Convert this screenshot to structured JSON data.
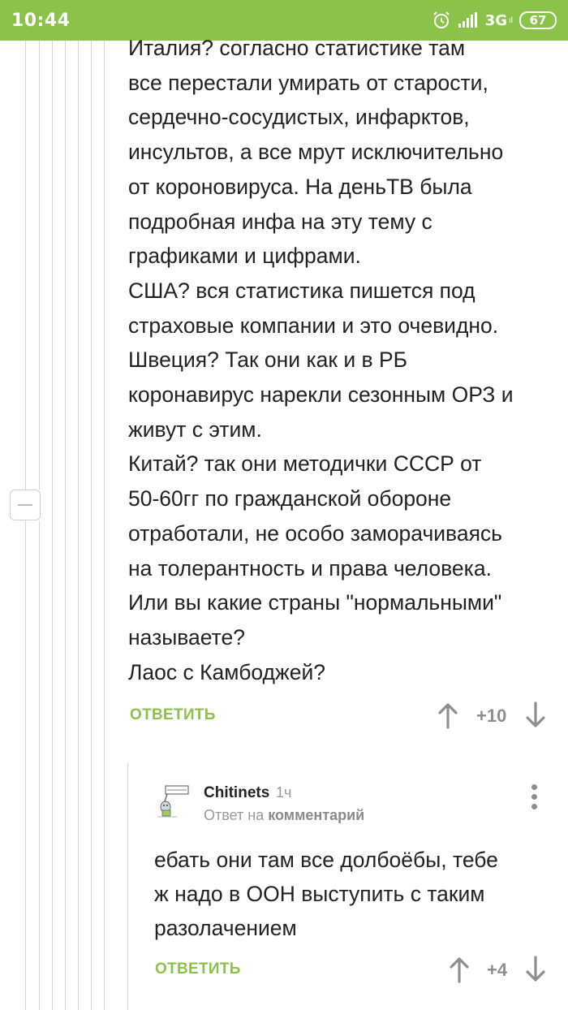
{
  "status_bar": {
    "time": "10:44",
    "network": "3G",
    "network_sub": "ıl",
    "battery": "67"
  },
  "comment": {
    "lines": [
      "Италия? согласно статистике там",
      "все перестали умирать от старости,",
      "сердечно-сосудистых, инфарктов,",
      "инсультов, а все мрут исключительно",
      "от короновируса. На деньТВ была",
      "подробная инфа на эту тему с",
      "графиками и цифрами.",
      "США? вся статистика пишется под",
      "страховые компании и это очевидно.",
      "Швеция? Так они как и в РБ",
      "коронавирус нарекли сезонным ОРЗ и",
      "живут с этим.",
      "Китай? так они методички СССР от",
      "50-60гг по гражданской обороне",
      "отработали, не особо заморачиваясь",
      "на толерантность и права человека.",
      "Или вы какие страны \"нормальными\"",
      "называете?",
      "Лаос с Камбоджей?"
    ],
    "reply_label": "ОТВЕТИТЬ",
    "rating": "+10"
  },
  "reply": {
    "author": "Chitinets",
    "time_ago": "1ч",
    "reply_to_prefix": "Ответ на",
    "reply_to_target": "комментарий",
    "lines": [
      "ебать они там все долбоёбы, тебе",
      "ж надо в ООН выступить с таким",
      "разолачением"
    ],
    "reply_label": "ОТВЕТИТЬ",
    "rating": "+4"
  },
  "colors": {
    "accent": "#8bc34a",
    "text": "#222222",
    "muted": "#9a9a9a",
    "thread_line": "#d6d6d6"
  },
  "icons": [
    "alarm-icon",
    "signal-icon",
    "battery-icon",
    "collapse-icon",
    "upvote-icon",
    "downvote-icon",
    "more-icon",
    "avatar"
  ]
}
